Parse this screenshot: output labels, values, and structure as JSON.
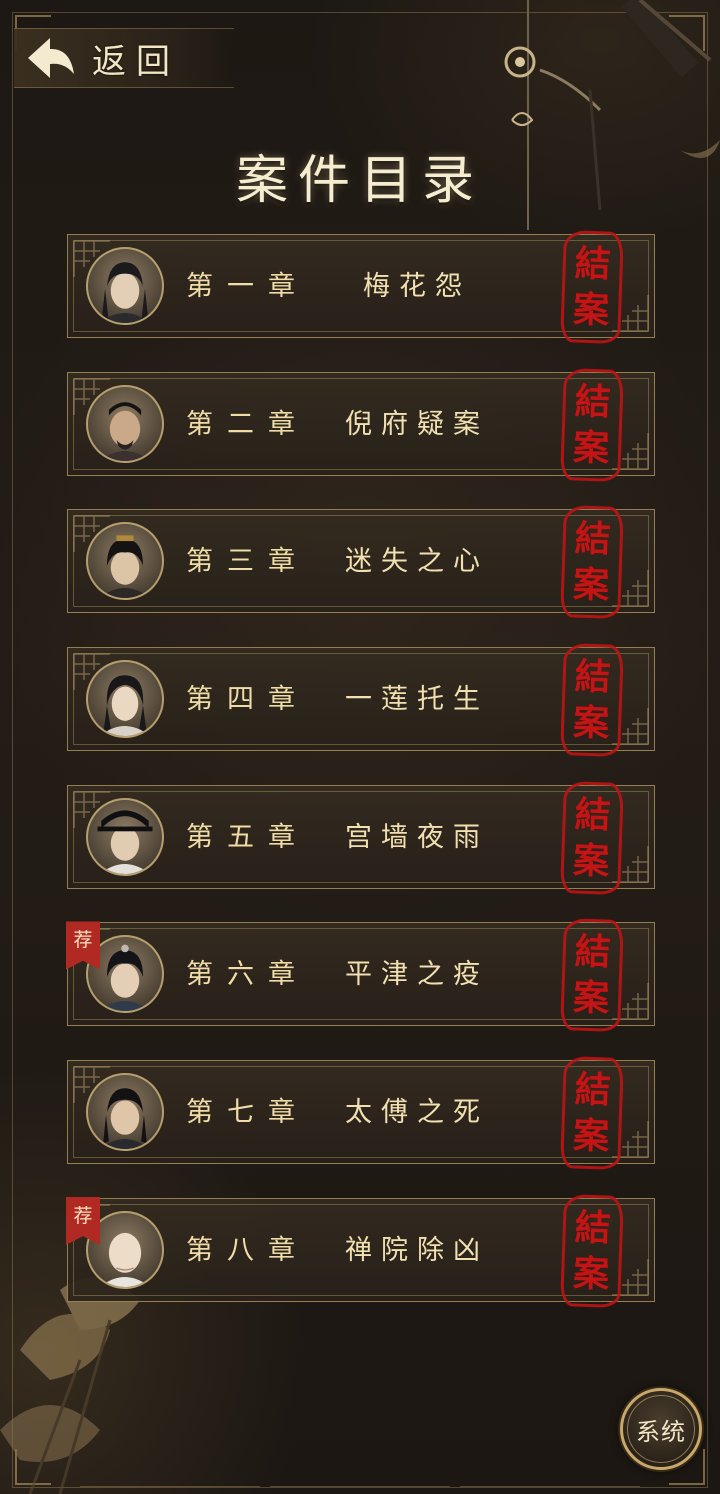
{
  "header": {
    "back_label": "返回",
    "title": "案件目录"
  },
  "chapters": [
    {
      "number": "第一章",
      "title": "梅花怨",
      "stamp": [
        "結",
        "案"
      ],
      "recommended": false
    },
    {
      "number": "第二章",
      "title": "倪府疑案",
      "stamp": [
        "結",
        "案"
      ],
      "recommended": false
    },
    {
      "number": "第三章",
      "title": "迷失之心",
      "stamp": [
        "結",
        "案"
      ],
      "recommended": false
    },
    {
      "number": "第四章",
      "title": "一莲托生",
      "stamp": [
        "結",
        "案"
      ],
      "recommended": false
    },
    {
      "number": "第五章",
      "title": "宫墙夜雨",
      "stamp": [
        "結",
        "案"
      ],
      "recommended": false
    },
    {
      "number": "第六章",
      "title": "平津之疫",
      "stamp": [
        "結",
        "案"
      ],
      "recommended": true,
      "badge": "荐"
    },
    {
      "number": "第七章",
      "title": "太傅之死",
      "stamp": [
        "結",
        "案"
      ],
      "recommended": false
    },
    {
      "number": "第八章",
      "title": "禅院除凶",
      "stamp": [
        "結",
        "案"
      ],
      "recommended": true,
      "badge": "荐"
    }
  ],
  "system_button": {
    "label": "系统"
  },
  "icons": {
    "back": "back-arrow-icon",
    "stamp": "closed-case-stamp-icon",
    "badge": "recommend-ribbon-icon"
  },
  "colors": {
    "background": "#1d1813",
    "gold_text": "#efdca6",
    "border_gold": "#af965f",
    "stamp_red": "#c81616",
    "badge_red": "#b02a23"
  }
}
